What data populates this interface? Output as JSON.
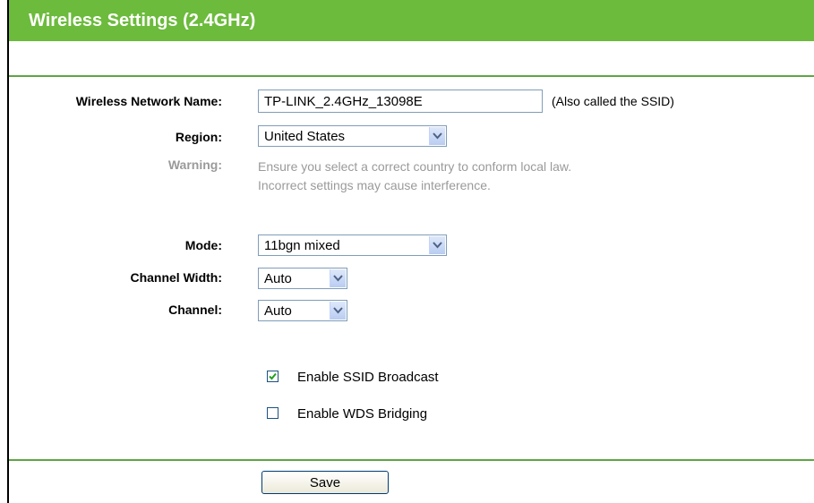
{
  "header": {
    "title": "Wireless Settings (2.4GHz)"
  },
  "form": {
    "ssid": {
      "label": "Wireless Network Name:",
      "value": "TP-LINK_2.4GHz_13098E",
      "hint": "(Also called the SSID)"
    },
    "region": {
      "label": "Region:",
      "value": "United States"
    },
    "warning": {
      "label": "Warning:",
      "line1": "Ensure you select a correct country to conform local law.",
      "line2": "Incorrect settings may cause interference."
    },
    "mode": {
      "label": "Mode:",
      "value": "11bgn mixed"
    },
    "channel_width": {
      "label": "Channel Width:",
      "value": "Auto"
    },
    "channel": {
      "label": "Channel:",
      "value": "Auto"
    },
    "ssid_broadcast": {
      "label": "Enable SSID Broadcast",
      "checked": true
    },
    "wds_bridging": {
      "label": "Enable WDS Bridging",
      "checked": false
    }
  },
  "footer": {
    "save_label": "Save"
  },
  "colors": {
    "header_bg": "#6cbb3c",
    "divider": "#5fa544",
    "muted_text": "#9a9a9a"
  }
}
